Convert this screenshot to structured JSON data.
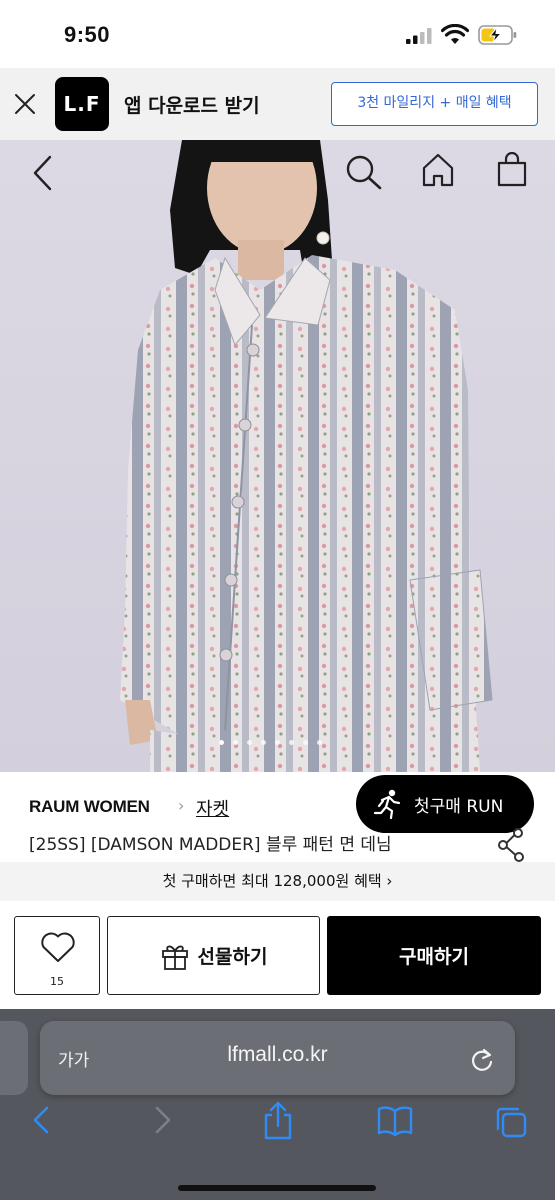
{
  "status_bar": {
    "time": "9:50"
  },
  "app_banner": {
    "logo_text": "L.F",
    "title": "앱 다운로드 받기",
    "promo_button": "3천 마일리지 + 매일 혜택"
  },
  "hero": {
    "image_count": 8,
    "active_index": 0,
    "icons": [
      "back-icon",
      "search-icon",
      "home-icon",
      "shopping-bag-icon"
    ]
  },
  "product": {
    "brand": "RAUM WOMEN",
    "separator": "›",
    "category": "자켓",
    "name": "[25SS] [DAMSON MADDER] 블루 패턴 면 데님"
  },
  "run_button": {
    "label": "첫구매 RUN"
  },
  "benefit_bar": {
    "text": "첫 구매하면 최대 128,000원 혜택 ›"
  },
  "actions": {
    "like_count": "15",
    "gift_label": "선물하기",
    "buy_label": "구매하기"
  },
  "browser": {
    "aa_label": "가가",
    "url": "lfmall.co.kr"
  },
  "colors": {
    "promo_blue": "#3568d4",
    "safari_toolbar": "#54575d",
    "safari_icon_blue": "#2f8cf7"
  }
}
